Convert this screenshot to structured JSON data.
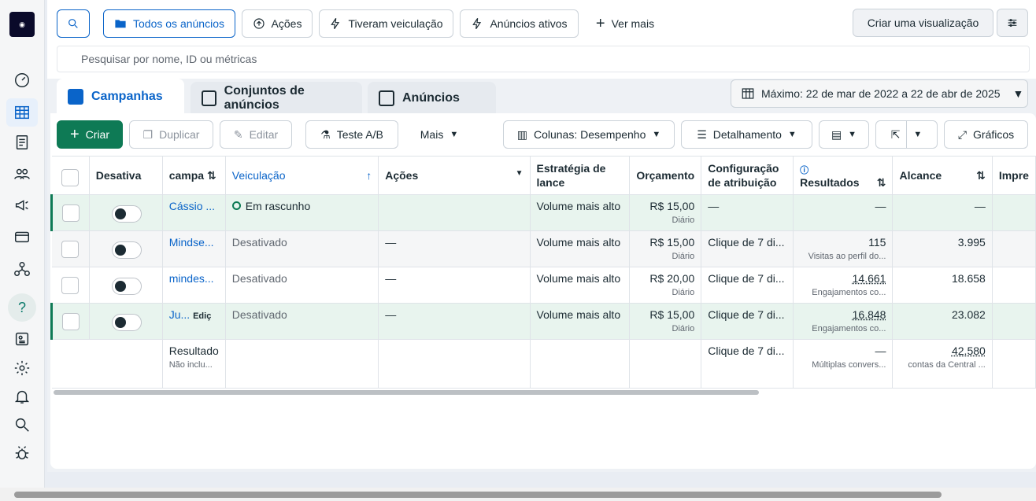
{
  "toolbar": {
    "filters": [
      "Todos os anúncios",
      "Ações",
      "Tiveram veiculação",
      "Anúncios ativos"
    ],
    "see_more": "Ver mais",
    "create_view": "Criar uma visualização",
    "search_placeholder": "Pesquisar por nome, ID ou métricas"
  },
  "tabs": [
    "Campanhas",
    "Conjuntos de anúncios",
    "Anúncios"
  ],
  "date_range": "Máximo: 22 de mar de 2022 a 22 de abr de 2025",
  "actions": {
    "create": "Criar",
    "duplicate": "Duplicar",
    "edit": "Editar",
    "ab_test": "Teste A/B",
    "more": "Mais",
    "columns": "Colunas: Desempenho",
    "breakdown": "Detalhamento",
    "charts": "Gráficos"
  },
  "table": {
    "headers": {
      "status": "Desativa",
      "campaign": "campa",
      "delivery": "Veiculação",
      "actions": "Ações",
      "bid": "Estratégia de lance",
      "budget": "Orçamento",
      "attribution": "Configuração de atribuição",
      "results": "Resultados",
      "reach": "Alcance",
      "impressions": "Impre"
    },
    "rows": [
      {
        "name": "Cássio ...",
        "delivery": "Em rascunho",
        "actions": "",
        "bid": "Volume mais alto",
        "budget": "R$ 15,00",
        "budget_sub": "Diário",
        "attribution": "—",
        "results": "—",
        "results_sub": "",
        "reach": "—",
        "reach_sub": ""
      },
      {
        "name": "Mindse...",
        "delivery": "Desativado",
        "actions": "—",
        "bid": "Volume mais alto",
        "budget": "R$ 15,00",
        "budget_sub": "Diário",
        "attribution": "Clique de 7 di...",
        "results": "115",
        "results_sub": "Visitas ao perfil do...",
        "reach": "3.995",
        "reach_sub": ""
      },
      {
        "name": "mindes...",
        "delivery": "Desativado",
        "actions": "—",
        "bid": "Volume mais alto",
        "budget": "R$ 20,00",
        "budget_sub": "Diário",
        "attribution": "Clique de 7 di...",
        "results": "14.661",
        "results_sub": "Engajamentos co...",
        "reach": "18.658",
        "reach_sub": ""
      },
      {
        "name": "Ju...",
        "edit_label": "Ediç",
        "delivery": "Desativado",
        "actions": "—",
        "bid": "Volume mais alto",
        "budget": "R$ 15,00",
        "budget_sub": "Diário",
        "attribution": "Clique de 7 di...",
        "results": "16.848",
        "results_sub": "Engajamentos co...",
        "reach": "23.082",
        "reach_sub": ""
      }
    ],
    "summary": {
      "label": "Resultado",
      "sub": "Não inclu...",
      "attribution": "Clique de 7 di...",
      "results": "—",
      "results_sub": "Múltiplas convers...",
      "reach": "42.580",
      "reach_sub": "contas da Central ..."
    }
  },
  "colors": {
    "primary": "#0a64c9",
    "green": "#0e7a55"
  }
}
